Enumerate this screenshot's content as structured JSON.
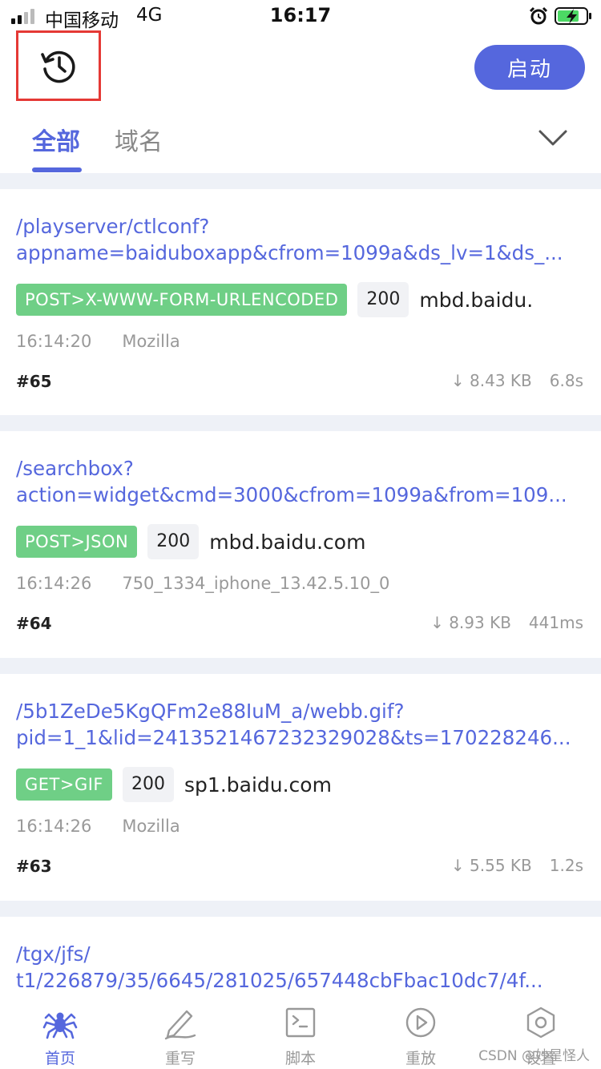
{
  "status_bar": {
    "carrier": "中国移动",
    "network": "4G",
    "time": "16:17"
  },
  "header": {
    "history_icon": "history-clock-icon",
    "start_label": "启动"
  },
  "tabs": {
    "items": [
      {
        "label": "全部"
      },
      {
        "label": "域名"
      }
    ],
    "active": "全部",
    "expand_icon": "chevron-down-icon"
  },
  "colors": {
    "accent": "#5567dd",
    "method_tag": "#6fcf86",
    "highlight_border": "#e53935"
  },
  "requests": [
    {
      "path_line1": "/playserver/ctlconf?",
      "path_line2": "appname=baiduboxapp&cfrom=1099a&ds_lv=1&ds_...",
      "method": "POST>X-WWW-FORM-URLENCODED",
      "status": "200",
      "host": "mbd.baidu.",
      "time": "16:14:20",
      "ua": "Mozilla",
      "id": "#65",
      "size": "↓ 8.43 KB",
      "duration": "6.8s"
    },
    {
      "path_line1": "/searchbox?",
      "path_line2": "action=widget&cmd=3000&cfrom=1099a&from=109...",
      "method": "POST>JSON",
      "status": "200",
      "host": "mbd.baidu.com",
      "time": "16:14:26",
      "ua": "750_1334_iphone_13.42.5.10_0",
      "id": "#64",
      "size": "↓ 8.93 KB",
      "duration": "441ms"
    },
    {
      "path_line1": "/5b1ZeDe5KgQFm2e88IuM_a/webb.gif?",
      "path_line2": "pid=1_1&lid=2413521467232329028&ts=170228246...",
      "method": "GET>GIF",
      "status": "200",
      "host": "sp1.baidu.com",
      "time": "16:14:26",
      "ua": "Mozilla",
      "id": "#63",
      "size": "↓ 5.55 KB",
      "duration": "1.2s"
    },
    {
      "path_line1": "/tgx/jfs/",
      "path_line2": "t1/226879/35/6645/281025/657448cbFbac10dc7/4f...",
      "method": "",
      "status": "",
      "host": "",
      "time": "",
      "ua": "",
      "id": "",
      "size": "",
      "duration": ""
    }
  ],
  "bottom_nav": [
    {
      "label": "首页",
      "icon": "spider-icon",
      "active": true
    },
    {
      "label": "重写",
      "icon": "pen-icon",
      "active": false
    },
    {
      "label": "脚本",
      "icon": "terminal-icon",
      "active": false
    },
    {
      "label": "重放",
      "icon": "play-icon",
      "active": false
    },
    {
      "label": "设置",
      "icon": "settings-hex-icon",
      "active": false
    }
  ],
  "watermark": "CSDN @妙星怪人"
}
